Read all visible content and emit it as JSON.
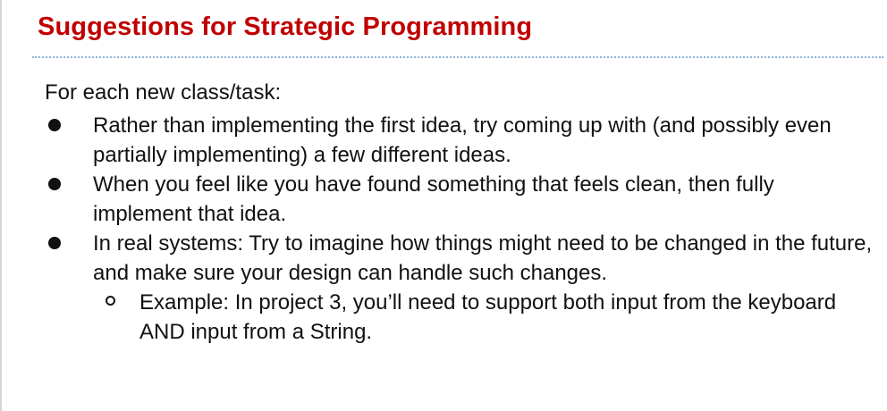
{
  "slide": {
    "title": "Suggestions for Strategic Programming",
    "intro": "For each new class/task:",
    "bullets": [
      {
        "text": "Rather than implementing the first idea, try coming up with (and possibly even partially implementing) a few different ideas."
      },
      {
        "text": "When you feel like you have found something that feels clean, then fully implement that idea."
      },
      {
        "text": "In real systems: Try to imagine how things might need to be changed in the future, and make sure your design can handle such changes.",
        "sub_bullets": [
          {
            "text": "Example: In project 3, you’ll need to support both input from the keyboard AND input from a String."
          }
        ]
      }
    ]
  },
  "colors": {
    "title": "#c00000",
    "divider": "#8fb3d9",
    "text": "#111111"
  },
  "icons": {
    "bullet": "filled-circle-bullet-icon",
    "sub_bullet": "hollow-circle-bullet-icon"
  }
}
